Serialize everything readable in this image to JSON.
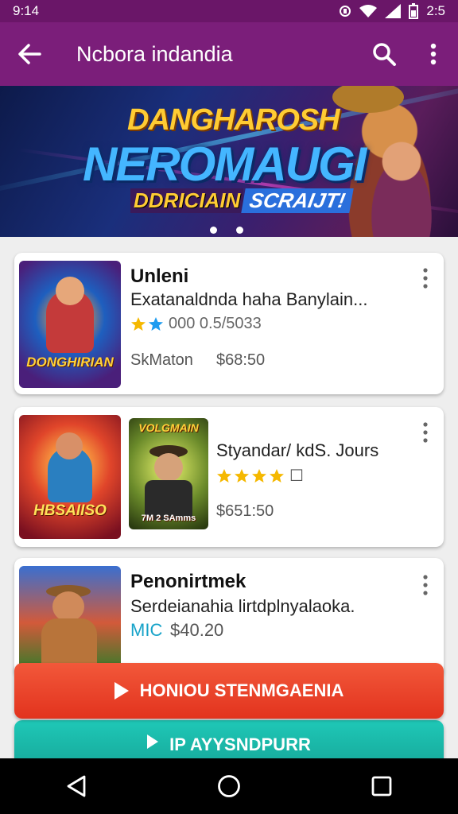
{
  "status": {
    "time": "9:14",
    "clock_right": "2:5"
  },
  "appbar": {
    "title": "Ncbora indandia"
  },
  "banner": {
    "line1": "DANGHAROSH",
    "line2": "NEROMAUGI",
    "sub_a": "DDRICIAIN",
    "sub_b": "SCRAIJT!",
    "slides": 2
  },
  "cards": [
    {
      "thumb_caption": "DONGHIRIAN",
      "name": "Unleni",
      "desc": "Exatanaldnda haha Banylain...",
      "rating_stars": 2,
      "rating_text": "000 0.5/5033",
      "seller": "SkMaton",
      "price": "$68:50"
    },
    {
      "thumb_caption": "HBSAIISO",
      "thumb2_top": "VOLGMAIN",
      "thumb2_bottom": "7M 2 SAmms",
      "name": "Styandar/ kdS. Jours",
      "rating_stars": 4,
      "rating_extra": "☐",
      "price": "$651:50"
    },
    {
      "thumb_caption": "",
      "name": "Penonirtmek",
      "desc": "Serdeianahia lirtdplnyalaoka.",
      "tag": "MIC",
      "price": "$40.20"
    }
  ],
  "buttons": {
    "primary": "HONIOU STENMGAENIA",
    "secondary": "IP AYYSNDPURR"
  },
  "colors": {
    "appbar": "#7b1e7a",
    "statusbar": "#6a1668",
    "primary_button": "#e8452a",
    "secondary_button": "#1cbcac",
    "star_gold": "#f5b800",
    "star_blue": "#1e9cf0",
    "accent_teal": "#17a3c9"
  }
}
